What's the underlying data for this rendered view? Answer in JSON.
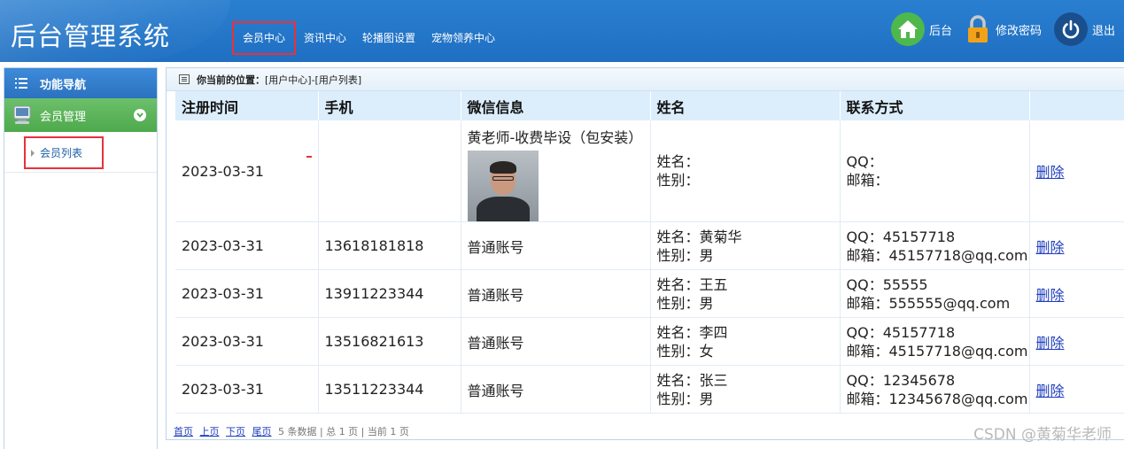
{
  "header": {
    "title": "后台管理系统",
    "nav": [
      "会员中心",
      "资讯中心",
      "轮播图设置",
      "宠物领养中心"
    ],
    "right": {
      "home_label": "后台",
      "password_label": "修改密码",
      "logout_label": "退出"
    }
  },
  "colors": {
    "header_blue": "#2377c9",
    "sidebar_green": "#5db35b",
    "highlight_red": "#e8323a",
    "table_header_bg": "#dceefb",
    "link_blue": "#1f3fbf"
  },
  "sidebar": {
    "title": "功能导航",
    "group": "会员管理",
    "item": "会员列表"
  },
  "breadcrumb": {
    "prefix": "你当前的位置：",
    "path": "[用户中心]-[用户列表]"
  },
  "table": {
    "headers": [
      "注册时间",
      "手机",
      "微信信息",
      "姓名",
      "联系方式",
      ""
    ],
    "rows": [
      {
        "date": "2023-03-31",
        "phone": "",
        "wechat": "黄老师-收费毕设（包安装）",
        "name": "姓名：",
        "gender": "性别：",
        "qq": "QQ：",
        "email": "邮箱：",
        "action": "删除"
      },
      {
        "date": "2023-03-31",
        "phone": "13618181818",
        "wechat": "普通账号",
        "name": "姓名：黄菊华",
        "gender": "性别：男",
        "qq": "QQ：45157718",
        "email": "邮箱：45157718@qq.com",
        "action": "删除"
      },
      {
        "date": "2023-03-31",
        "phone": "13911223344",
        "wechat": "普通账号",
        "name": "姓名：王五",
        "gender": "性别：男",
        "qq": "QQ：55555",
        "email": "邮箱：555555@qq.com",
        "action": "删除"
      },
      {
        "date": "2023-03-31",
        "phone": "13516821613",
        "wechat": "普通账号",
        "name": "姓名：李四",
        "gender": "性别：女",
        "qq": "QQ：45157718",
        "email": "邮箱：45157718@qq.com",
        "action": "删除"
      },
      {
        "date": "2023-03-31",
        "phone": "13511223344",
        "wechat": "普通账号",
        "name": "姓名：张三",
        "gender": "性别：男",
        "qq": "QQ：12345678",
        "email": "邮箱：12345678@qq.com",
        "action": "删除"
      }
    ]
  },
  "pager": {
    "first": "首页",
    "prev": "上页",
    "next": "下页",
    "last": "尾页",
    "info": "5 条数据 | 总 1 页 | 当前 1 页"
  },
  "watermark": "CSDN @黄菊华老师"
}
